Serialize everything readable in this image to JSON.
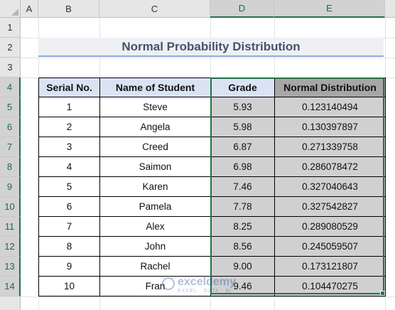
{
  "columns": [
    "A",
    "B",
    "C",
    "D",
    "E"
  ],
  "rows": [
    "1",
    "2",
    "3",
    "4",
    "5",
    "6",
    "7",
    "8",
    "9",
    "10",
    "11",
    "12",
    "13",
    "14"
  ],
  "title": "Normal Probability Distribution",
  "table": {
    "headers": [
      "Serial No.",
      "Name of Student",
      "Grade",
      "Normal Distribution"
    ],
    "records": [
      [
        "1",
        "Steve",
        "5.93",
        "0.123140494"
      ],
      [
        "2",
        "Angela",
        "5.98",
        "0.130397897"
      ],
      [
        "3",
        "Creed",
        "6.87",
        "0.271339758"
      ],
      [
        "4",
        "Saimon",
        "6.98",
        "0.286078472"
      ],
      [
        "5",
        "Karen",
        "7.46",
        "0.327040643"
      ],
      [
        "6",
        "Pamela",
        "7.78",
        "0.327542827"
      ],
      [
        "7",
        "Alex",
        "8.25",
        "0.289080529"
      ],
      [
        "8",
        "John",
        "8.56",
        "0.245059507"
      ],
      [
        "9",
        "Rachel",
        "9.00",
        "0.173121807"
      ],
      [
        "10",
        "Fran",
        "9.46",
        "0.104470275"
      ]
    ]
  },
  "watermark": {
    "name": "exceldemy",
    "tagline": "EXCEL · DATA · BI"
  },
  "colors": {
    "accent": "#217346",
    "title_text": "#44546a",
    "header_fill": "#dae3f3",
    "selection_fill": "#d0d0d0"
  }
}
